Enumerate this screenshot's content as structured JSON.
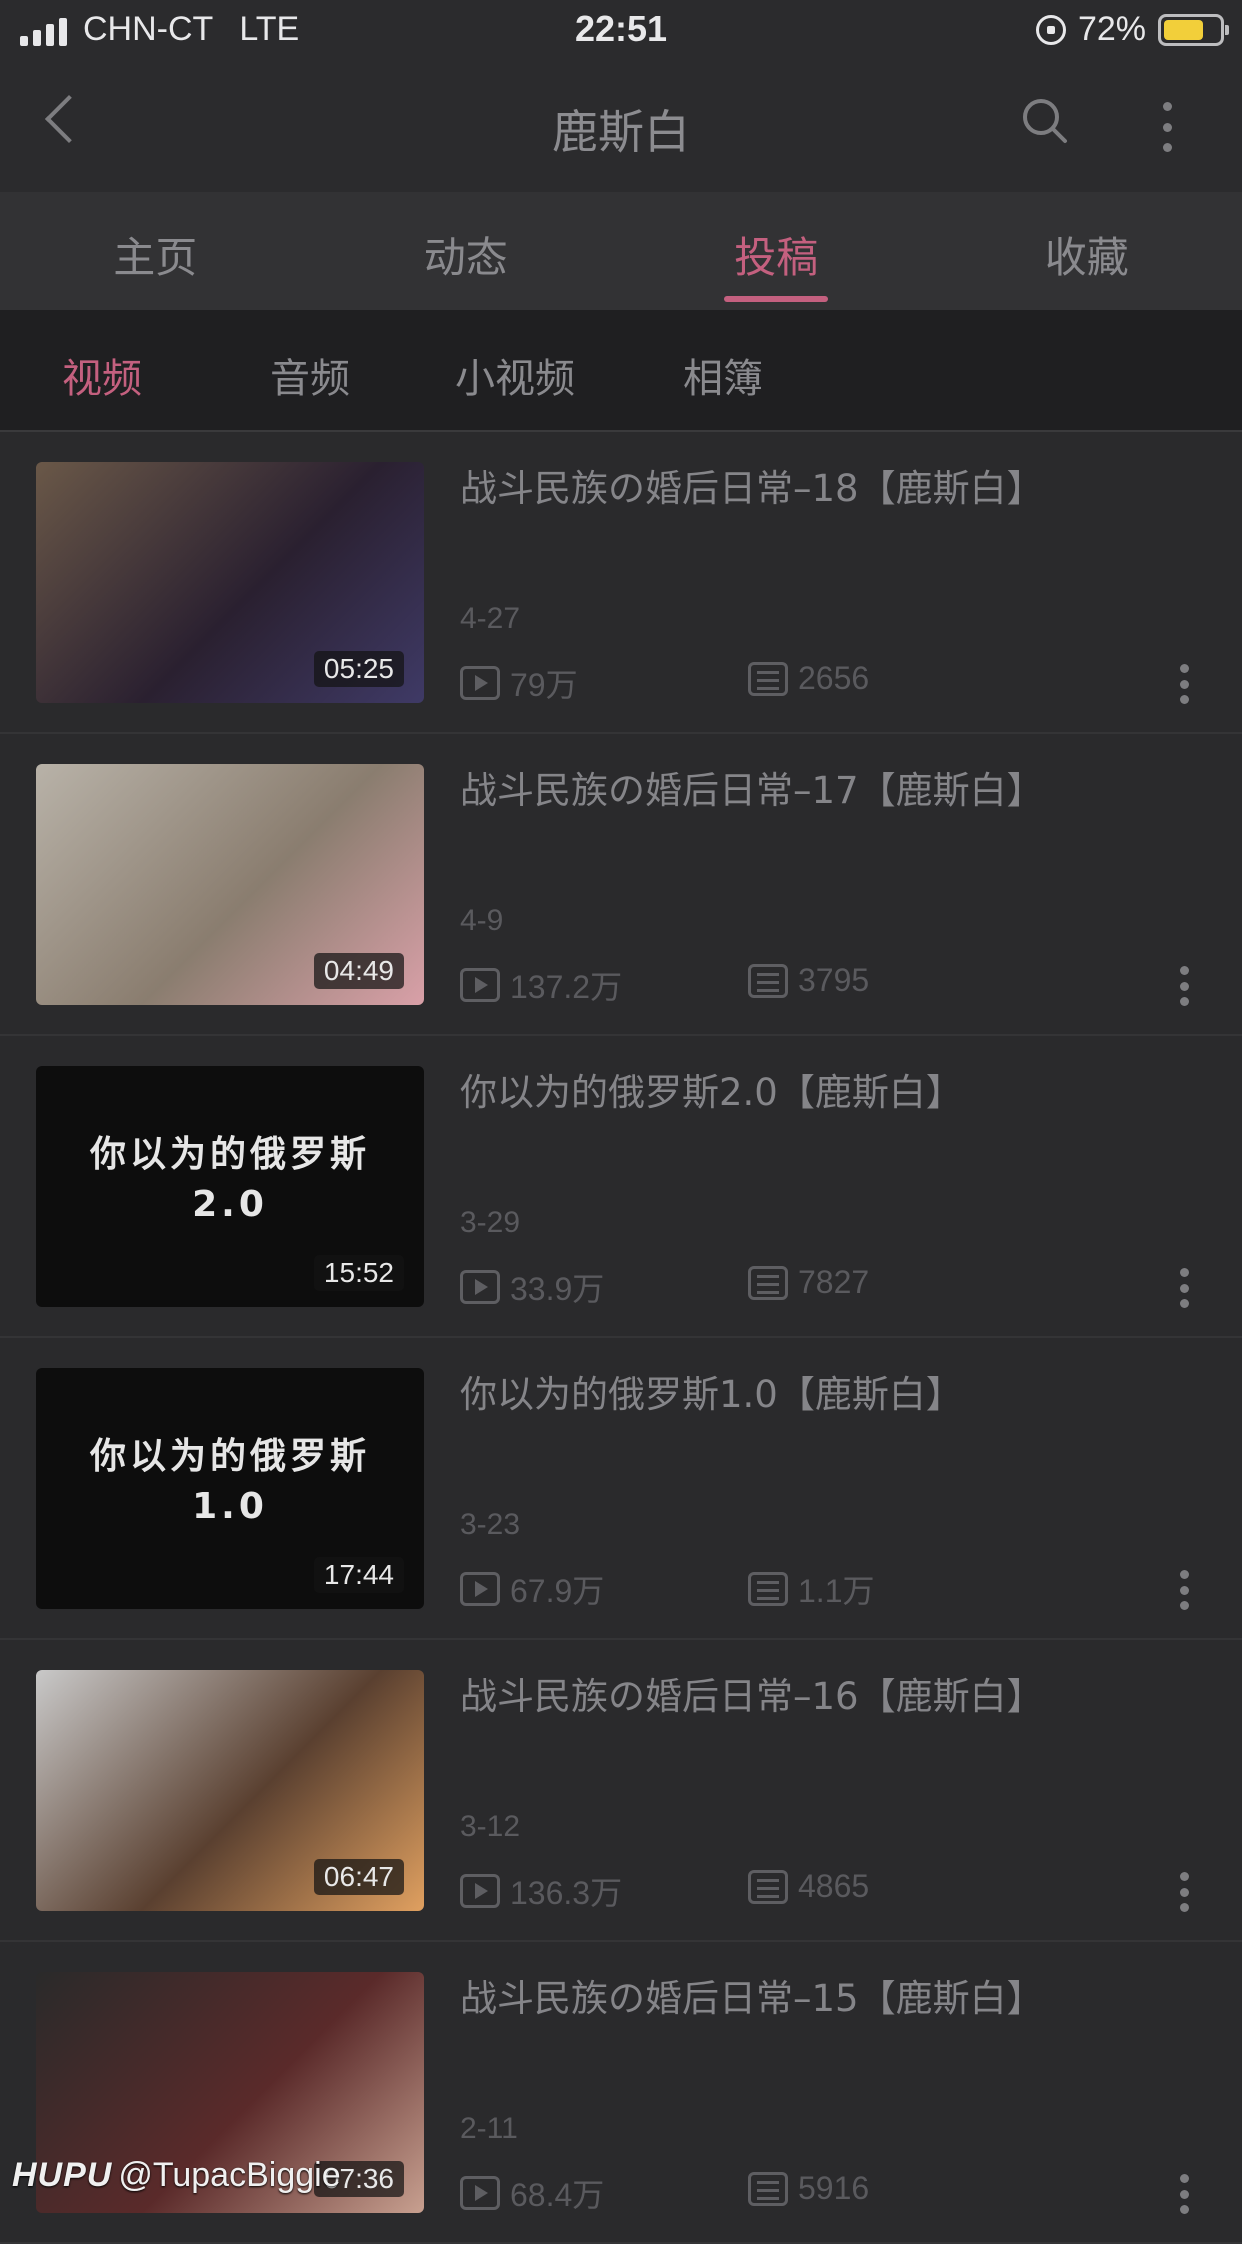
{
  "status_bar": {
    "carrier": "CHN-CT",
    "network": "LTE",
    "time": "22:51",
    "battery": "72%"
  },
  "nav": {
    "title": "鹿斯白"
  },
  "tabs": [
    {
      "label": "主页"
    },
    {
      "label": "动态"
    },
    {
      "label": "投稿",
      "active": true
    },
    {
      "label": "收藏"
    }
  ],
  "subtabs": [
    {
      "label": "视频",
      "active": true
    },
    {
      "label": "音频"
    },
    {
      "label": "小视频"
    },
    {
      "label": "相簿"
    }
  ],
  "videos": [
    {
      "title": "战斗民族の婚后日常–18【鹿斯白】",
      "date": "4-27",
      "views": "79万",
      "comments": "2656",
      "duration": "05:25",
      "thumb_text_1": "",
      "thumb_text_2": "",
      "thumb_colors": [
        "#6a5848",
        "#2a2030",
        "#3f3a66"
      ]
    },
    {
      "title": "战斗民族の婚后日常–17【鹿斯白】",
      "date": "4-9",
      "views": "137.2万",
      "comments": "3795",
      "duration": "04:49",
      "thumb_text_1": "",
      "thumb_text_2": "",
      "thumb_colors": [
        "#b8b2a8",
        "#8a7d6f",
        "#d9a0a8"
      ]
    },
    {
      "title": "你以为的俄罗斯2.0【鹿斯白】",
      "date": "3-29",
      "views": "33.9万",
      "comments": "7827",
      "duration": "15:52",
      "thumb_text_1": "你以为的俄罗斯",
      "thumb_text_2": "2.0",
      "thumb_colors": [
        "#0d0d0d",
        "#0d0d0d",
        "#0d0d0d"
      ]
    },
    {
      "title": "你以为的俄罗斯1.0【鹿斯白】",
      "date": "3-23",
      "views": "67.9万",
      "comments": "1.1万",
      "duration": "17:44",
      "thumb_text_1": "你以为的俄罗斯",
      "thumb_text_2": "1.0",
      "thumb_colors": [
        "#0d0d0d",
        "#0d0d0d",
        "#0d0d0d"
      ]
    },
    {
      "title": "战斗民族の婚后日常–16【鹿斯白】",
      "date": "3-12",
      "views": "136.3万",
      "comments": "4865",
      "duration": "06:47",
      "thumb_text_1": "",
      "thumb_text_2": "",
      "thumb_colors": [
        "#c9c9c9",
        "#5a4030",
        "#e0a060"
      ]
    },
    {
      "title": "战斗民族の婚后日常–15【鹿斯白】",
      "date": "2-11",
      "views": "68.4万",
      "comments": "5916",
      "duration": "07:36",
      "thumb_text_1": "",
      "thumb_text_2": "",
      "thumb_colors": [
        "#2a2a2a",
        "#5a2a2a",
        "#c8a090"
      ]
    }
  ],
  "watermark": {
    "logo": "HUPU",
    "user": "@TupacBiggie"
  }
}
